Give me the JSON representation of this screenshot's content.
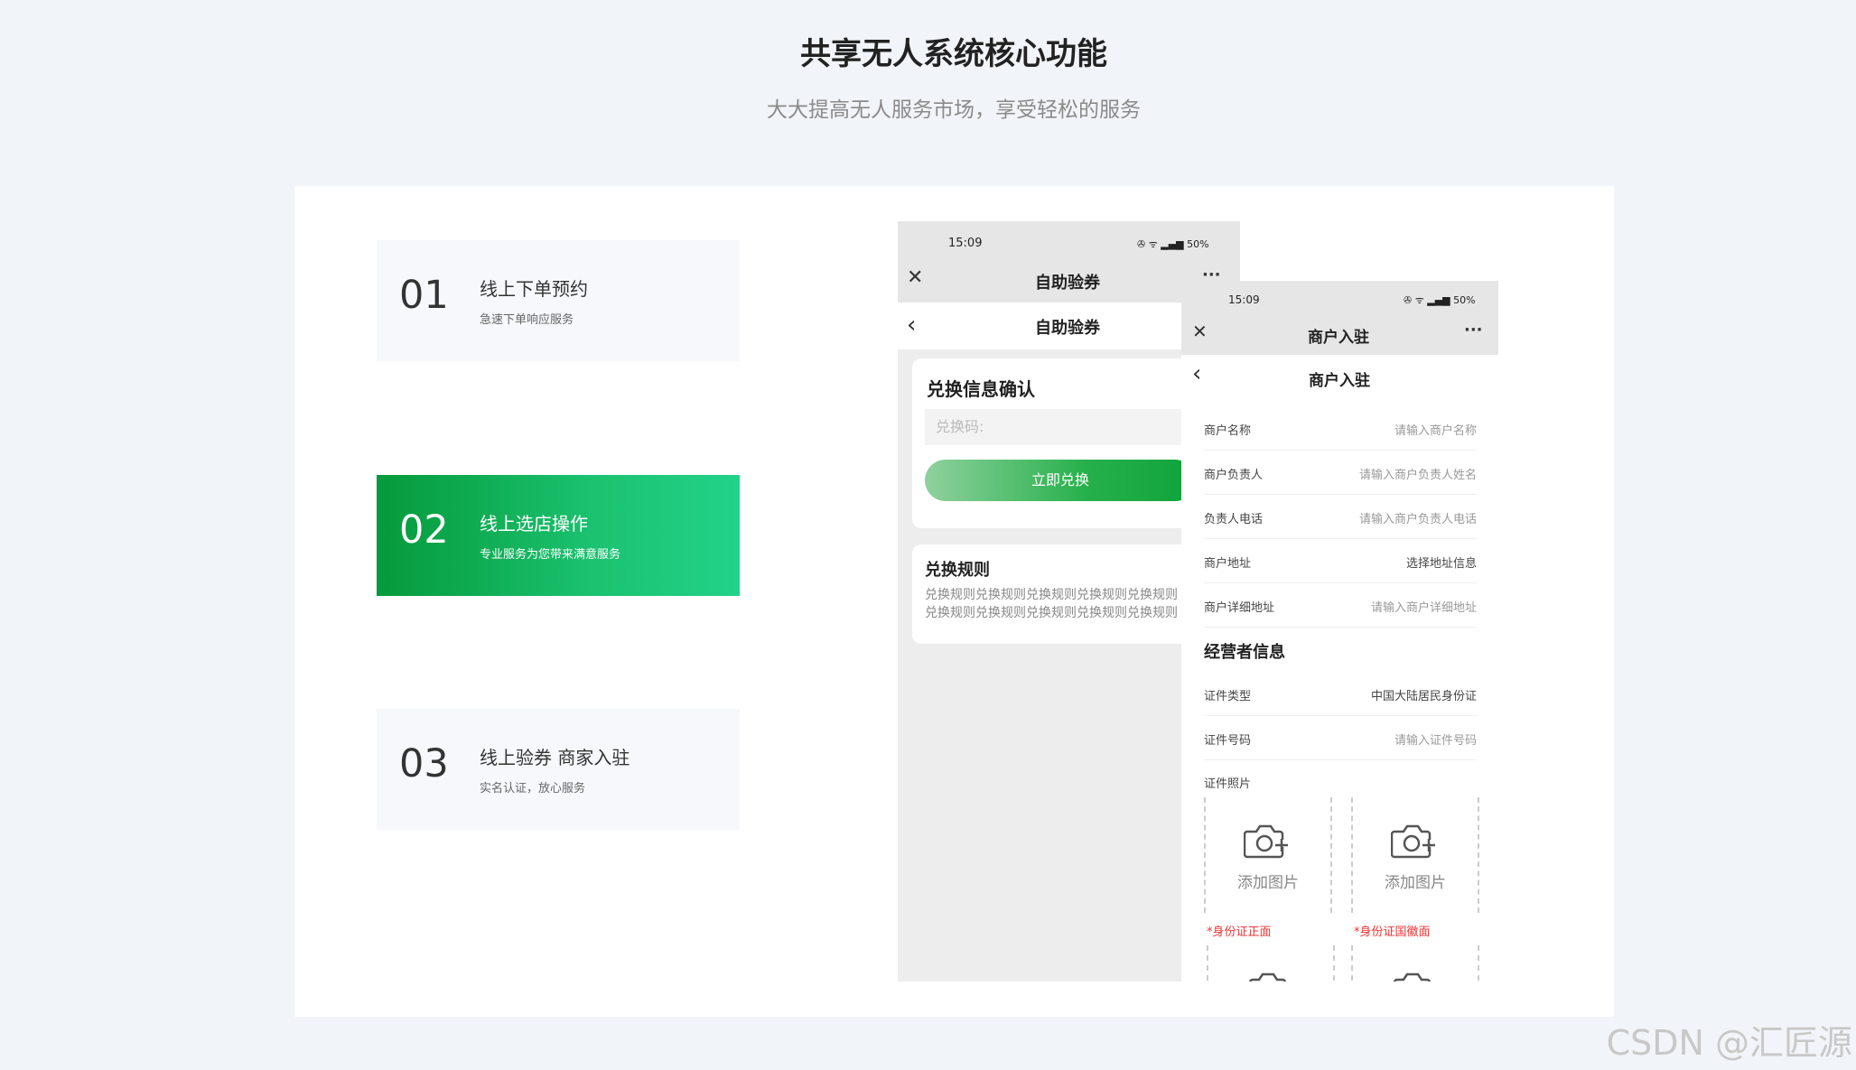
{
  "header": {
    "title": "共享无人系统核心功能",
    "subtitle": "大大提高无人服务市场，享受轻松的服务"
  },
  "features": [
    {
      "num": "01",
      "title": "线上下单预约",
      "desc": "急速下单响应服务"
    },
    {
      "num": "02",
      "title": "线上选店操作",
      "desc": "专业服务为您带来满意服务"
    },
    {
      "num": "03",
      "title": "线上验券 商家入驻",
      "desc": "实名认证，放心服务"
    }
  ],
  "phone1": {
    "time": "15:09",
    "status": "✇ ᯤ ▂▄▆ 50%",
    "top_title": "自助验券",
    "nav_title": "自助验券",
    "confirm_title": "兑换信息确认",
    "code_placeholder": "兑换码:",
    "redeem_button": "立即兑换",
    "rules_title": "兑换规则",
    "rules_text": "兑换规则兑换规则兑换规则兑换规则兑换规则兑换规则兑换规则兑换规则兑换规则兑换规则"
  },
  "phone2": {
    "time": "15:09",
    "status": "✇ ᯤ ▂▄▆ 50%",
    "top_title": "商户入驻",
    "nav_title": "商户入驻",
    "fields": [
      {
        "label": "商户名称",
        "value": "请输入商户名称"
      },
      {
        "label": "商户负责人",
        "value": "请输入商户负责人姓名"
      },
      {
        "label": "负责人电话",
        "value": "请输入商户负责人电话"
      },
      {
        "label": "商户地址",
        "value": "选择地址信息"
      },
      {
        "label": "商户详细地址",
        "value": "请输入商户详细地址"
      }
    ],
    "operator_title": "经营者信息",
    "operator_fields": [
      {
        "label": "证件类型",
        "value": "中国大陆居民身份证"
      },
      {
        "label": "证件号码",
        "value": "请输入证件号码"
      }
    ],
    "photo_label": "证件照片",
    "upload_label": "添加图片",
    "id_front": "*身份证正面",
    "id_back": "*身份证国徽面"
  },
  "watermark": "CSDN @汇匠源"
}
